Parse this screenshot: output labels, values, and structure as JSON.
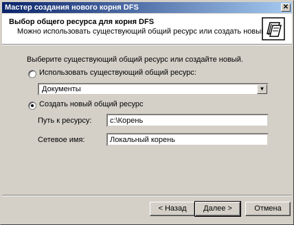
{
  "window": {
    "title": "Мастер создания нового корня DFS",
    "close_glyph": "✕"
  },
  "header": {
    "title": "Выбор общего ресурса для корня DFS",
    "subtitle": "Можно использовать существующий общий ресурс или создать новый.",
    "icon": "folder-tree-icon"
  },
  "body": {
    "instruction": "Выберите существующий общий ресурс или создайте новый.",
    "option_existing": {
      "label": "Использовать существующий общий ресурс:",
      "checked": false
    },
    "existing_share_select": {
      "value": "Документы"
    },
    "option_new": {
      "label": "Создать новый общий ресурс",
      "checked": true
    },
    "path_label": "Путь к ресурсу:",
    "path_value": "c:\\Корень",
    "share_name_label": "Сетевое имя:",
    "share_name_value": "Локальный корень"
  },
  "buttons": {
    "back": "< Назад",
    "next": "Далее >",
    "cancel": "Отмена"
  }
}
